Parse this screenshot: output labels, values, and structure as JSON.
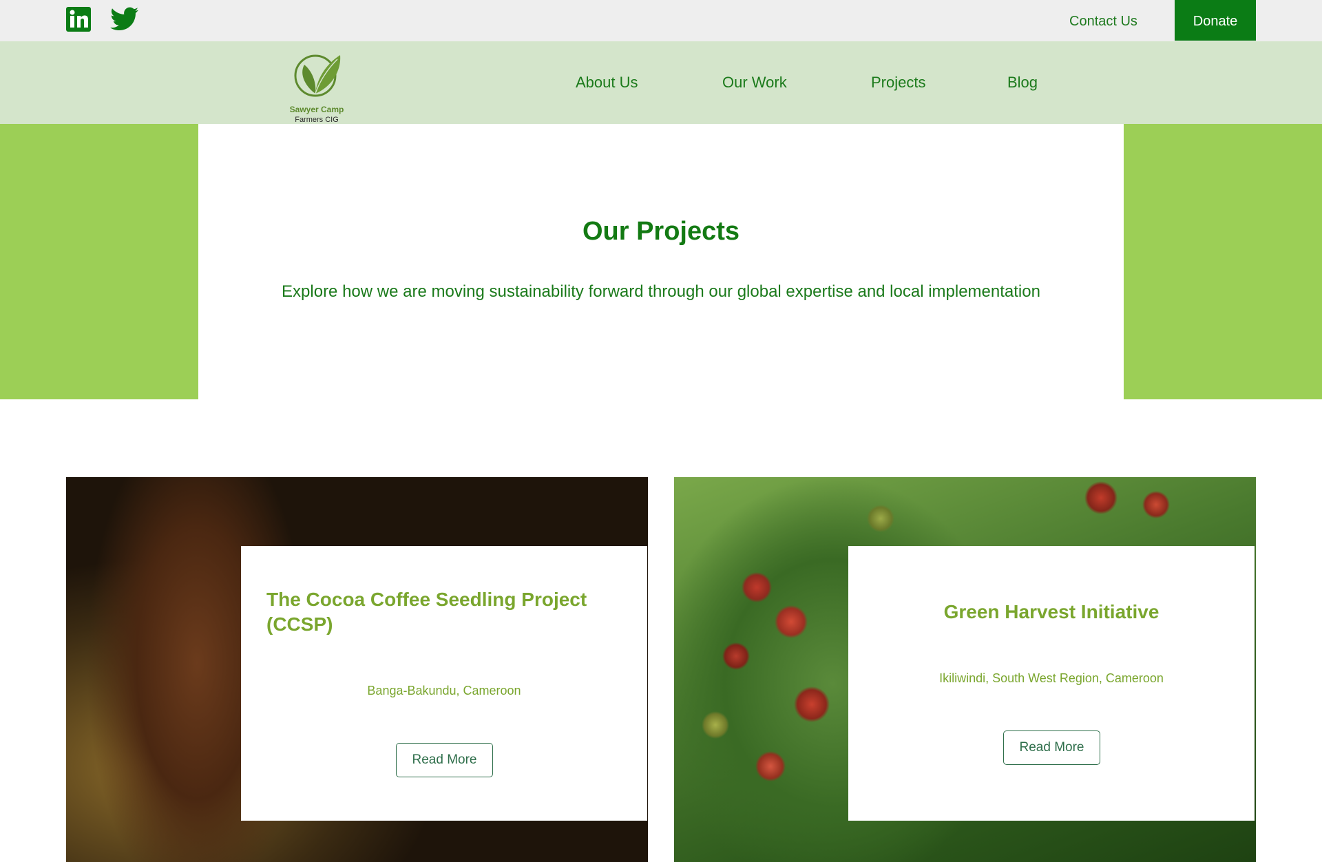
{
  "topbar": {
    "social": [
      "linkedin-icon",
      "twitter-icon"
    ],
    "contact_label": "Contact Us",
    "donate_label": "Donate"
  },
  "nav": {
    "logo": {
      "line1": "Sawyer Camp",
      "line2": "Farmers CIG"
    },
    "items": [
      {
        "label": "About Us"
      },
      {
        "label": "Our Work"
      },
      {
        "label": "Projects"
      },
      {
        "label": "Blog"
      }
    ]
  },
  "hero": {
    "title": "Our Projects",
    "subtitle": "Explore how we are moving sustainability forward through our global expertise and local implementation"
  },
  "projects": [
    {
      "title": "The Cocoa Coffee Seedling Project (CCSP)",
      "location": "Banga-Bakundu, Cameroon",
      "button": "Read More"
    },
    {
      "title": "Green Harvest Initiative",
      "location": "Ikiliwindi, South West Region, Cameroon",
      "button": "Read More"
    }
  ],
  "colors": {
    "brand_green": "#0b7c15",
    "light_green": "#9ccf56",
    "nav_bg": "#d4e5cb",
    "accent_olive": "#7aa62e"
  }
}
